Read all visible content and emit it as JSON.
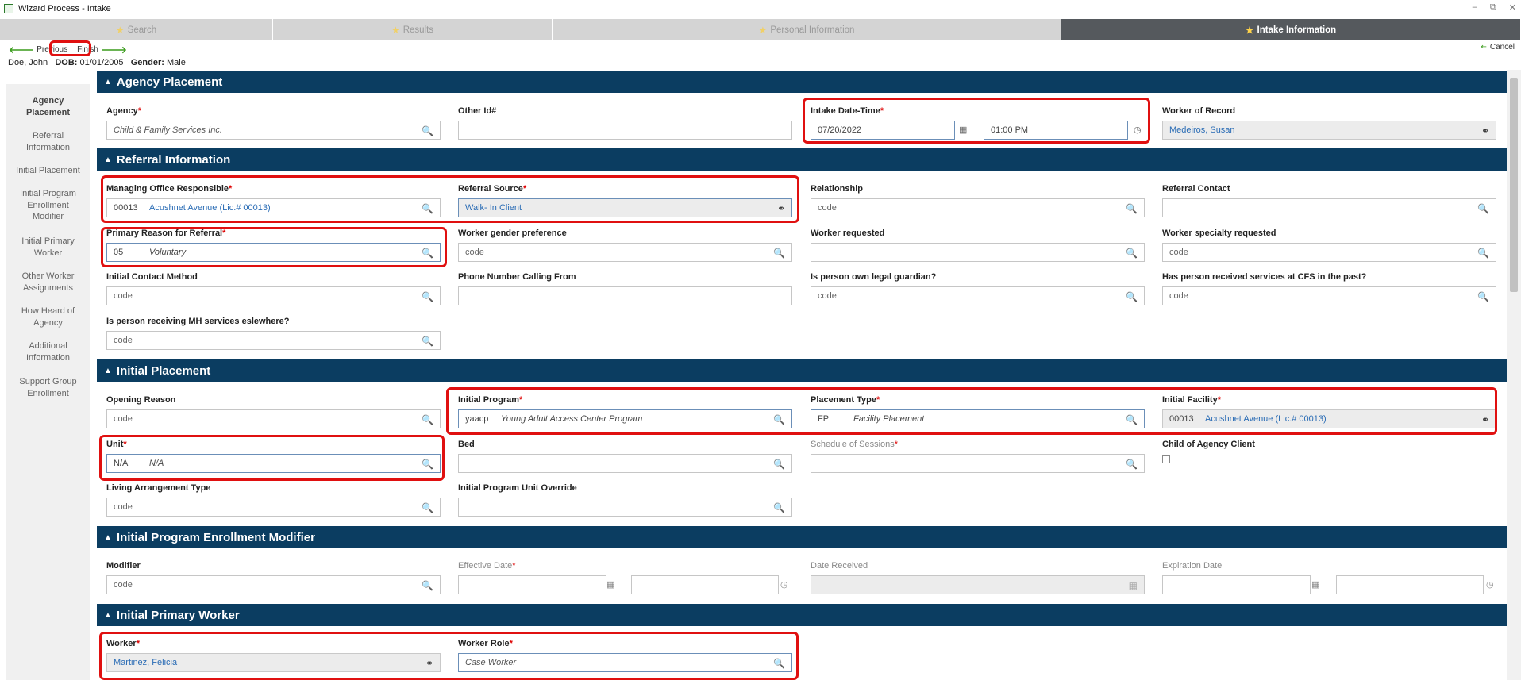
{
  "window": {
    "title": "Wizard Process - Intake",
    "controls": [
      "–",
      "⧉",
      "✕"
    ]
  },
  "wizard_tabs": [
    {
      "label": "Search",
      "active": false
    },
    {
      "label": "Results",
      "active": false
    },
    {
      "label": "Personal Information",
      "active": false
    },
    {
      "label": "Intake Information",
      "active": true
    }
  ],
  "nav": {
    "previous": "Previous",
    "finish": "Finish",
    "cancel": "Cancel"
  },
  "patient": {
    "name": "Doe, John",
    "dob_label": "DOB:",
    "dob": "01/01/2005",
    "gender_label": "Gender:",
    "gender": "Male"
  },
  "sidebar": [
    {
      "label": "Agency Placement",
      "active": true
    },
    {
      "label": "Referral Information",
      "active": false
    },
    {
      "label": "Initial Placement",
      "active": false
    },
    {
      "label": "Initial Program Enrollment Modifier",
      "active": false
    },
    {
      "label": "Initial Primary Worker",
      "active": false
    },
    {
      "label": "Other Worker Assignments",
      "active": false
    },
    {
      "label": "How Heard of Agency",
      "active": false
    },
    {
      "label": "Additional Information",
      "active": false
    },
    {
      "label": "Support Group Enrollment",
      "active": false
    }
  ],
  "sections": {
    "agency_placement": {
      "title": "Agency Placement",
      "agency": {
        "label": "Agency",
        "value": "Child & Family Services Inc."
      },
      "other_id": {
        "label": "Other Id#",
        "value": ""
      },
      "intake_datetime": {
        "label": "Intake Date-Time",
        "date": "07/20/2022",
        "time": "01:00 PM"
      },
      "worker_of_record": {
        "label": "Worker of Record",
        "value": "Medeiros, Susan"
      }
    },
    "referral_information": {
      "title": "Referral Information",
      "managing_office": {
        "label": "Managing Office Responsible",
        "code": "00013",
        "value": "Acushnet Avenue (Lic.# 00013)"
      },
      "referral_source": {
        "label": "Referral Source",
        "value": "Walk- In Client"
      },
      "relationship": {
        "label": "Relationship",
        "placeholder": "code"
      },
      "referral_contact": {
        "label": "Referral Contact",
        "value": ""
      },
      "primary_reason": {
        "label": "Primary Reason for Referral",
        "code": "05",
        "value": "Voluntary"
      },
      "worker_gender_pref": {
        "label": "Worker gender preference",
        "placeholder": "code"
      },
      "worker_requested": {
        "label": "Worker requested",
        "value": ""
      },
      "worker_specialty": {
        "label": "Worker specialty requested",
        "placeholder": "code"
      },
      "initial_contact_method": {
        "label": "Initial Contact Method",
        "placeholder": "code"
      },
      "phone_calling_from": {
        "label": "Phone Number Calling From",
        "value": ""
      },
      "own_legal_guardian": {
        "label": "Is person own legal guardian?",
        "placeholder": "code"
      },
      "received_services_past": {
        "label": "Has person received services at CFS in the past?",
        "placeholder": "code"
      },
      "receiving_mh_services": {
        "label": "Is person receiving MH services eslewhere?",
        "placeholder": "code"
      }
    },
    "initial_placement": {
      "title": "Initial Placement",
      "opening_reason": {
        "label": "Opening Reason",
        "placeholder": "code"
      },
      "initial_program": {
        "label": "Initial Program",
        "code": "yaacp",
        "value": "Young Adult Access Center Program"
      },
      "placement_type": {
        "label": "Placement Type",
        "code": "FP",
        "value": "Facility Placement"
      },
      "initial_facility": {
        "label": "Initial Facility",
        "code": "00013",
        "value": "Acushnet Avenue (Lic.# 00013)"
      },
      "unit": {
        "label": "Unit",
        "code": "N/A",
        "value": "N/A"
      },
      "bed": {
        "label": "Bed",
        "value": ""
      },
      "schedule_of_sessions": {
        "label": "Schedule of Sessions",
        "value": ""
      },
      "child_of_agency_client": {
        "label": "Child of Agency Client",
        "checked": false
      },
      "living_arrangement_type": {
        "label": "Living Arrangement Type",
        "placeholder": "code"
      },
      "initial_program_unit_override": {
        "label": "Initial Program Unit Override",
        "value": ""
      }
    },
    "program_enrollment_modifier": {
      "title": "Initial Program Enrollment Modifier",
      "modifier": {
        "label": "Modifier",
        "placeholder": "code"
      },
      "effective_date": {
        "label": "Effective Date"
      },
      "date_received": {
        "label": "Date Received"
      },
      "expiration_date": {
        "label": "Expiration Date"
      }
    },
    "primary_worker": {
      "title": "Initial Primary Worker",
      "worker": {
        "label": "Worker",
        "value": "Martinez, Felicia"
      },
      "worker_role": {
        "label": "Worker Role",
        "value": "Case Worker"
      }
    }
  },
  "icons": {
    "search": "search-icon",
    "binoculars": "binoculars-icon",
    "calendar": "calendar-icon",
    "clock": "clock-icon"
  },
  "colors": {
    "section_header": "#0b3d61",
    "highlight": "#e01010",
    "active_tab": "#55595d",
    "link": "#2a6cb5"
  }
}
